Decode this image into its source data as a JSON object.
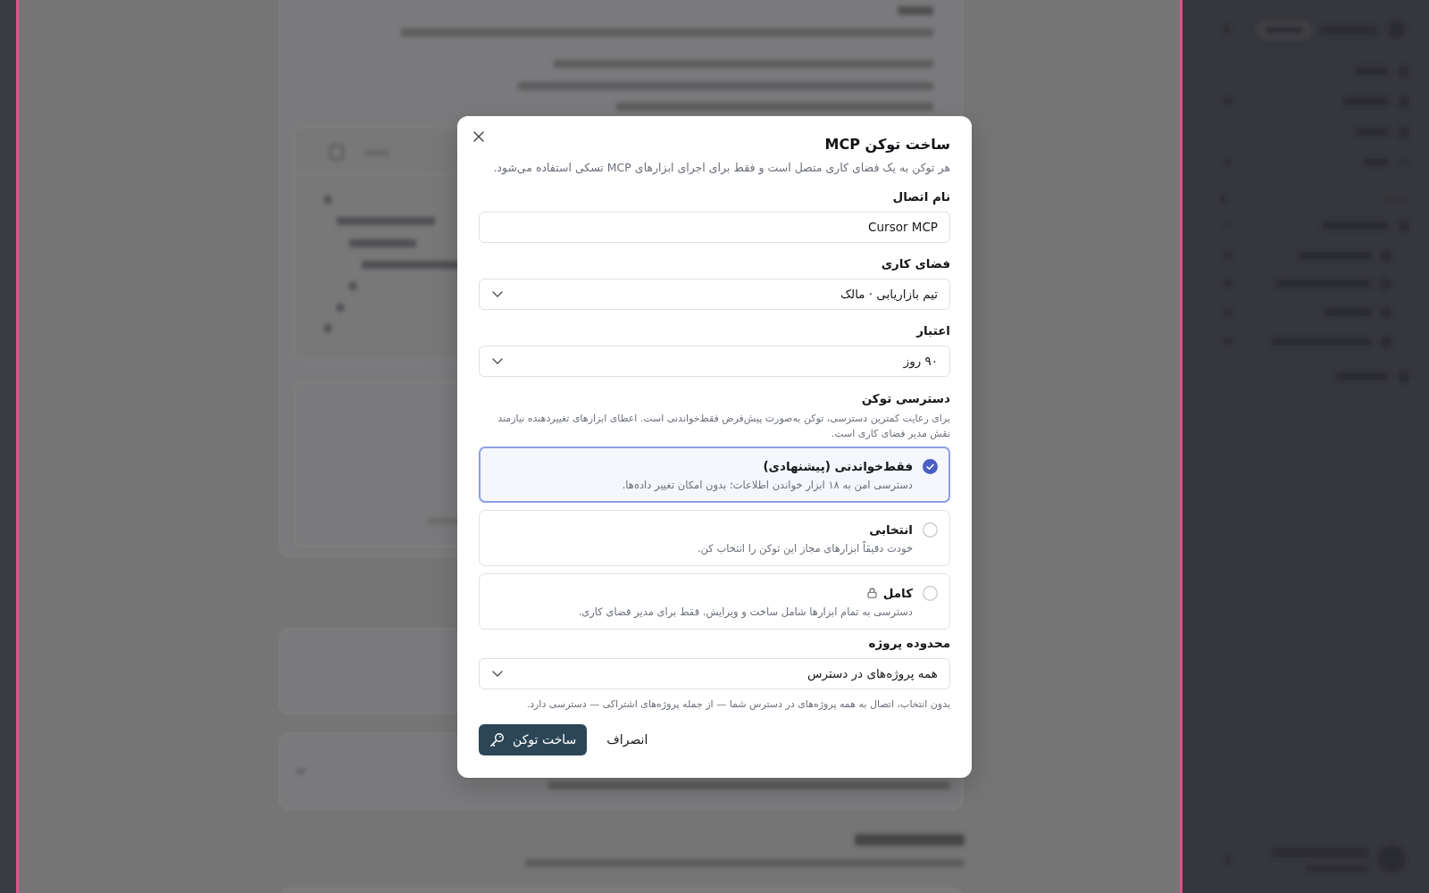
{
  "dialog": {
    "title": "ساخت توکن MCP",
    "description": "هر توکن به یک فضای کاری متصل است و فقط برای اجرای ابزارهای MCP تسکی استفاده می‌شود.",
    "fields": [
      {
        "kind": "text",
        "label": "نام اتصال",
        "value": "Cursor MCP"
      },
      {
        "kind": "select",
        "label": "فضای کاری",
        "value": "تیم بازاریابی · مالک"
      },
      {
        "kind": "select",
        "label": "اعتبار",
        "value": "۹۰ روز"
      }
    ],
    "access": {
      "label": "دسترسی توکن",
      "hint": "برای رعایت کمترین دسترسی، توکن به‌صورت پیش‌فرض فقط‌خواندنی است. اعطای ابزارهای تغییردهنده نیازمند نقش مدیر فضای کاری است.",
      "options": [
        {
          "title": "فقط‌خواندنی (پیشنهادی)",
          "description": "دسترسی امن به ۱۸ ابزار خواندن اطلاعات؛ بدون امکان تغییر داده‌ها.",
          "selected": true,
          "locked": false
        },
        {
          "title": "انتخابی",
          "description": "خودت دقیقاً ابزارهای مجاز این توکن را انتخاب کن.",
          "selected": false,
          "locked": false
        },
        {
          "title": "کامل",
          "description": "دسترسی به تمام ابزارها شامل ساخت و ویرایش. فقط برای مدیر فضای کاری.",
          "selected": false,
          "locked": true
        }
      ]
    },
    "project_scope": {
      "label": "محدوده پروژه",
      "value": "همه پروژه‌های در دسترس",
      "hint": "بدون انتخاب، اتصال به همه پروژه‌های در دسترس شما — از جمله پروژه‌های اشتراکی — دسترسی دارد."
    },
    "buttons": [
      {
        "kind": "secondary",
        "label": "انصراف"
      },
      {
        "kind": "primary",
        "label": "ساخت توکن"
      }
    ]
  }
}
